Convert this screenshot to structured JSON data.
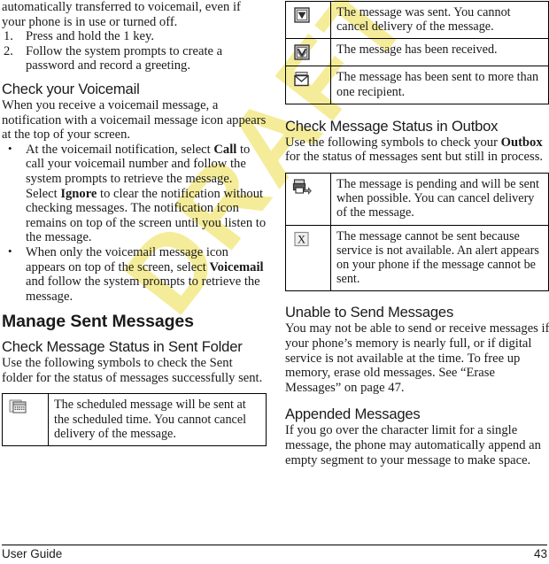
{
  "document": {
    "footer_left": "User Guide",
    "footer_page": "43",
    "watermark": "DRAFT",
    "watermark_color": "#f5ec9a"
  },
  "left_column": {
    "intro_paragraph": "automatically transferred to voicemail, even if your phone is in use or turned off.",
    "steps": [
      {
        "num": "1.",
        "text": "Press and hold the 1 key."
      },
      {
        "num": "2.",
        "text": "Follow the system prompts to create a password and record a greeting."
      }
    ],
    "section_voicemail": {
      "heading": "Check your Voicemail",
      "intro": "When you receive a voicemail message, a notification with a voicemail message icon appears at the top of your screen.",
      "bullets": [
        {
          "part1": "At the voicemail notification, select ",
          "bold1": "Call",
          "part2": " to call your voicemail number and follow the system prompts to retrieve the message. Select ",
          "bold2": "Ignore",
          "part3": " to clear the notification without checking messages. The notification icon remains on top of the screen until you listen to the message."
        },
        {
          "part1": "When only the voicemail message icon appears on top of the screen, select ",
          "bold1": "Voicemail",
          "part2": " and follow the system prompts to retrieve the message.",
          "bold2": "",
          "part3": ""
        }
      ]
    },
    "section_manage": {
      "heading": "Manage Sent Messages"
    },
    "section_sent_folder": {
      "heading": "Check Message Status in Sent Folder",
      "intro": "Use the following symbols to check the Sent folder for the status of messages successfully sent.",
      "table_rows": [
        {
          "icon": "scheduled-message-icon",
          "description": "The scheduled message will be sent at the scheduled time. You cannot cancel delivery of the message."
        }
      ]
    }
  },
  "right_column": {
    "sent_folder_table_continued": [
      {
        "icon": "message-sent-checkbox-icon",
        "description": "The message was sent. You cannot cancel delivery of the message."
      },
      {
        "icon": "message-received-checkbox-icon",
        "description": "The message has been received."
      },
      {
        "icon": "multiple-recipients-envelope-icon",
        "description": "The message has been sent to more than one recipient."
      }
    ],
    "section_outbox": {
      "heading": "Check Message Status in Outbox",
      "intro_part1": "Use the following symbols to check your ",
      "intro_bold": "Outbox",
      "intro_part2": " for the status of messages sent but still in process.",
      "table_rows": [
        {
          "icon": "message-pending-icon",
          "description": "The message is pending and will be sent when possible. You can cancel delivery of the message."
        },
        {
          "icon": "message-failed-x-icon",
          "description": "The message cannot be sent because service is not available. An alert appears on your phone if the message cannot be sent."
        }
      ]
    },
    "section_unable": {
      "heading": "Unable to Send Messages",
      "body": "You may not be able to send or receive messages if your phone’s memory is nearly full, or if digital service is not available at the time. To free up memory, erase old messages. See “Erase Messages” on page 47."
    },
    "section_appended": {
      "heading": "Appended Messages",
      "body": "If you go over the character limit for a single message, the phone may automatically append an empty segment to your message to make space."
    }
  }
}
